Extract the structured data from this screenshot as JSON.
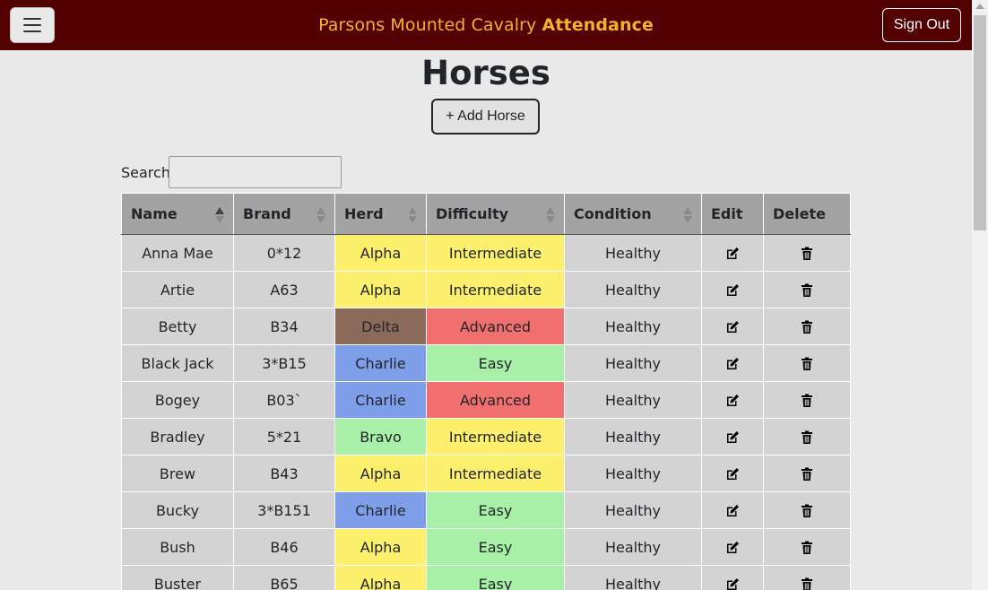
{
  "header": {
    "title_regular": "Parsons Mounted Cavalry",
    "title_bold": "Attendance",
    "sign_out_label": "Sign Out",
    "menu_icon": "hamburger-icon"
  },
  "page": {
    "title": "Horses",
    "add_button_label": "+ Add Horse",
    "search_label": "Search:",
    "search_value": ""
  },
  "table": {
    "columns": [
      "Name",
      "Brand",
      "Herd",
      "Difficulty",
      "Condition",
      "Edit",
      "Delete"
    ],
    "edit_icon": "edit-icon",
    "delete_icon": "trash-icon",
    "herd_colors": {
      "Alpha": "#fdf06c",
      "Bravo": "#a8f0a8",
      "Charlie": "#7f9eea",
      "Delta": "#8c6a5a"
    },
    "difficulty_colors": {
      "Easy": "#a8f0a8",
      "Intermediate": "#fdf06c",
      "Advanced": "#f07070"
    },
    "rows": [
      {
        "name": "Anna Mae",
        "brand": "0*12",
        "herd": "Alpha",
        "difficulty": "Intermediate",
        "condition": "Healthy"
      },
      {
        "name": "Artie",
        "brand": "A63",
        "herd": "Alpha",
        "difficulty": "Intermediate",
        "condition": "Healthy"
      },
      {
        "name": "Betty",
        "brand": "B34",
        "herd": "Delta",
        "difficulty": "Advanced",
        "condition": "Healthy"
      },
      {
        "name": "Black Jack",
        "brand": "3*B15",
        "herd": "Charlie",
        "difficulty": "Easy",
        "condition": "Healthy"
      },
      {
        "name": "Bogey",
        "brand": "B03`",
        "herd": "Charlie",
        "difficulty": "Advanced",
        "condition": "Healthy"
      },
      {
        "name": "Bradley",
        "brand": "5*21",
        "herd": "Bravo",
        "difficulty": "Intermediate",
        "condition": "Healthy"
      },
      {
        "name": "Brew",
        "brand": "B43",
        "herd": "Alpha",
        "difficulty": "Intermediate",
        "condition": "Healthy"
      },
      {
        "name": "Bucky",
        "brand": "3*B151",
        "herd": "Charlie",
        "difficulty": "Easy",
        "condition": "Healthy"
      },
      {
        "name": "Bush",
        "brand": "B46",
        "herd": "Alpha",
        "difficulty": "Easy",
        "condition": "Healthy"
      },
      {
        "name": "Buster",
        "brand": "B65",
        "herd": "Alpha",
        "difficulty": "Easy",
        "condition": "Healthy"
      }
    ]
  }
}
